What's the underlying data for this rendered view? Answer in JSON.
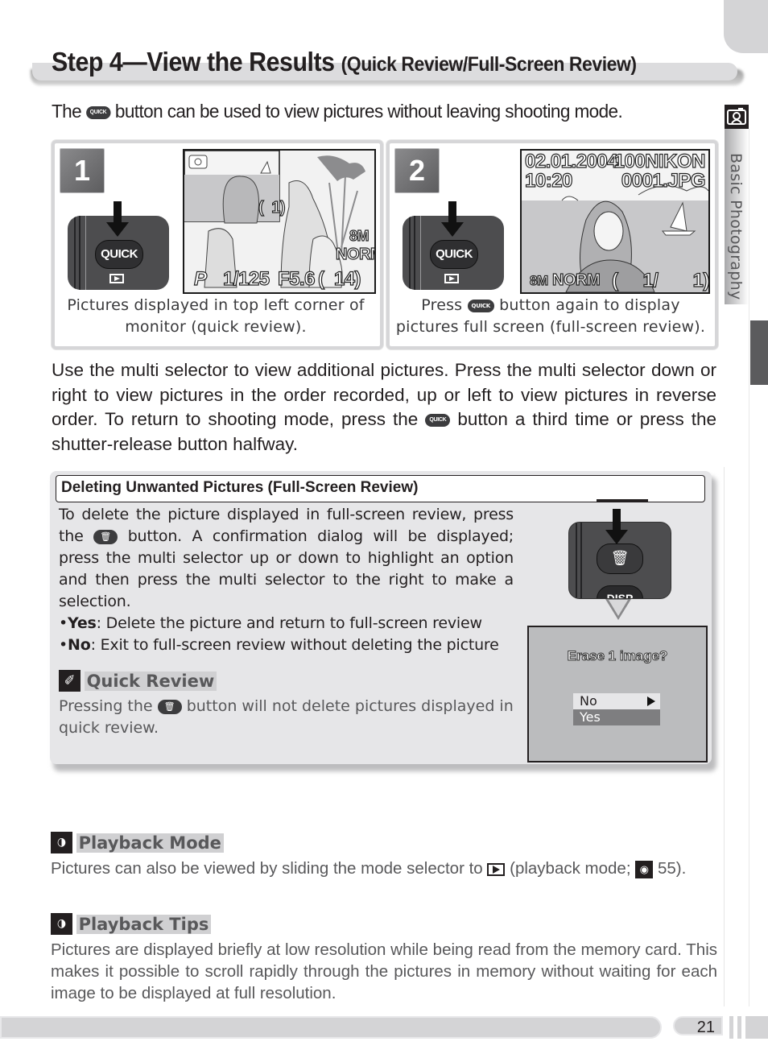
{
  "header": {
    "title": "Step 4—View the Results",
    "subtitle": "(Quick Review/Full-Screen Review)"
  },
  "lead": {
    "before": "The",
    "icon": "QUICK",
    "after": "button can be used to view pictures without leaving shooting mode."
  },
  "side_tab": {
    "icon": "camera-mode-icon",
    "label": "Basic Photography"
  },
  "steps": [
    {
      "number": "1",
      "button_label": "QUICK",
      "caption": "Pictures displayed in top left corner of monitor (quick review).",
      "screen": {
        "thumb_count": "1",
        "size": "8M",
        "quality": "NORM",
        "mode": "P",
        "shutter": "1/125",
        "aperture": "F5.6",
        "remaining": "14"
      }
    },
    {
      "number": "2",
      "button_label": "QUICK",
      "caption_before": "Press",
      "caption_icon": "QUICK",
      "caption_after": "button again to display pictures full screen (full-screen review).",
      "screen": {
        "date": "02.01.2004",
        "time": "10:20",
        "folder": "100NIKON",
        "file": "0001.JPG",
        "size": "8M",
        "quality": "NORM",
        "frame": "1/",
        "total": "1"
      }
    }
  ],
  "paragraph": {
    "before": "Use the multi selector to view additional pictures.  Press the multi selector down or right to view pictures in the order recorded, up or left to view pictures in reverse order.  To return to shooting mode, press the",
    "icon": "QUICK",
    "after": "button a third time or press the shutter-release button halfway."
  },
  "delete_box": {
    "title": "Deleting Unwanted Pictures (Full-Screen Review)",
    "text_before": "To delete the picture displayed in full-screen review, press the",
    "text_after": "button.  A confirmation dialog will be displayed; press the multi selector up or down to highlight an option and then press the multi selector to the right to make a selection.",
    "bullets": [
      {
        "term": "Yes",
        "desc": ": Delete the picture and return to full-screen review"
      },
      {
        "term": "No",
        "desc": ": Exit to full-screen review without deleting the picture"
      }
    ],
    "note_title": "Quick Review",
    "note_before": "Pressing the",
    "note_after": "button will not delete pictures displayed in quick review.",
    "camera_disp_label": "DISP",
    "dialog": {
      "question": "Erase 1 image?",
      "options": [
        "No",
        "Yes"
      ],
      "selected": "No"
    }
  },
  "playback_mode": {
    "title": "Playback Mode",
    "text_before": "Pictures can also be viewed by sliding the mode selector to",
    "text_middle": "(playback mode;",
    "text_after": "55)."
  },
  "playback_tips": {
    "title": "Playback Tips",
    "text": "Pictures are displayed briefly at low resolution while being read from the memory card. This makes it possible to scroll rapidly through the pictures in memory without waiting for each image to be displayed at full resolution."
  },
  "footer": {
    "page_number": "21"
  }
}
